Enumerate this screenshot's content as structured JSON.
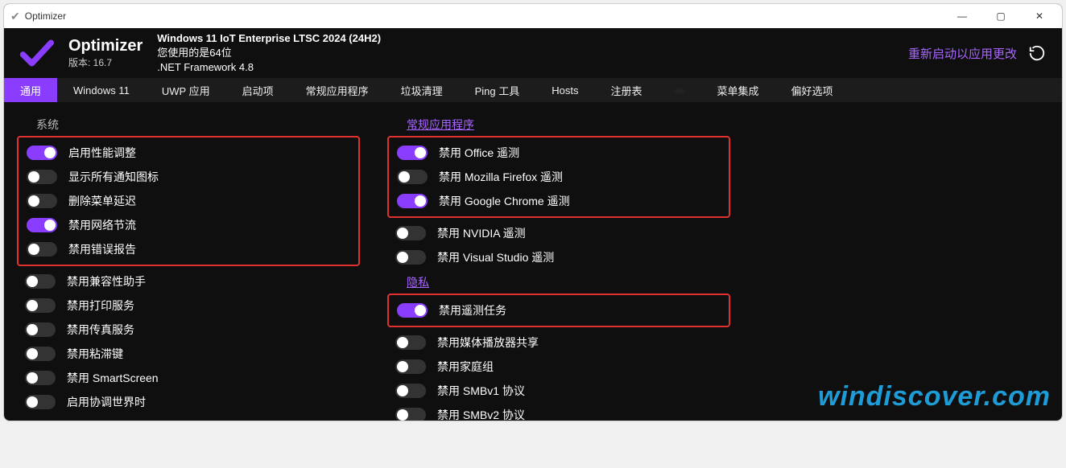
{
  "titlebar": {
    "title": "Optimizer"
  },
  "header": {
    "app_name": "Optimizer",
    "version_label": "版本: 16.7",
    "os_line": "Windows 11 IoT Enterprise LTSC 2024 (24H2)",
    "arch_line": "您使用的是64位",
    "net_line": ".NET Framework 4.8",
    "restart": "重新启动以应用更改"
  },
  "tabs": [
    "通用",
    "Windows 11",
    "UWP 应用",
    "启动项",
    "常规应用程序",
    "垃圾清理",
    "Ping 工具",
    "Hosts",
    "注册表",
    "",
    "菜单集成",
    "偏好选项"
  ],
  "active_tab": 0,
  "sections": {
    "system": {
      "title": "系统",
      "items": [
        {
          "label": "启用性能调整",
          "on": true
        },
        {
          "label": "显示所有通知图标",
          "on": false
        },
        {
          "label": "删除菜单延迟",
          "on": false
        },
        {
          "label": "禁用网络节流",
          "on": true
        },
        {
          "label": "禁用错误报告",
          "on": false
        },
        {
          "label": "禁用兼容性助手",
          "on": false
        },
        {
          "label": "禁用打印服务",
          "on": false
        },
        {
          "label": "禁用传真服务",
          "on": false
        },
        {
          "label": "禁用粘滞键",
          "on": false
        },
        {
          "label": "禁用 SmartScreen",
          "on": false
        },
        {
          "label": "启用协调世界时",
          "on": false
        }
      ]
    },
    "apps": {
      "title": "常规应用程序",
      "items": [
        {
          "label": "禁用 Office 遥测",
          "on": true
        },
        {
          "label": "禁用 Mozilla Firefox 遥测",
          "on": false
        },
        {
          "label": "禁用 Google Chrome 遥测",
          "on": true
        },
        {
          "label": "禁用 NVIDIA 遥测",
          "on": false
        },
        {
          "label": "禁用 Visual Studio 遥测",
          "on": false
        }
      ]
    },
    "privacy": {
      "title": "隐私",
      "items": [
        {
          "label": "禁用遥测任务",
          "on": true
        },
        {
          "label": "禁用媒体播放器共享",
          "on": false
        },
        {
          "label": "禁用家庭组",
          "on": false
        },
        {
          "label": "禁用 SMBv1 协议",
          "on": false
        },
        {
          "label": "禁用 SMBv2 协议",
          "on": false
        }
      ]
    }
  },
  "watermark": "windiscover.com"
}
